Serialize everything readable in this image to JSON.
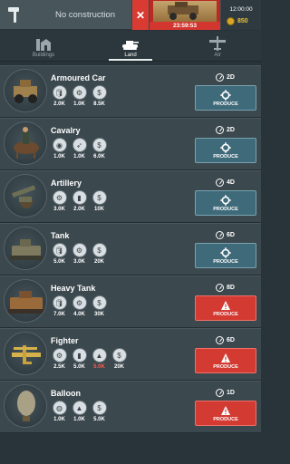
{
  "topbar": {
    "construction_text": "No construction",
    "cancel_symbol": "✕",
    "current_timer": "23:59:53",
    "clock_time": "12:00:00",
    "coins": "850"
  },
  "tabs": [
    {
      "label": "Buildings",
      "icon": "buildings-icon",
      "active": false
    },
    {
      "label": "Land",
      "icon": "tank-icon",
      "active": true
    },
    {
      "label": "Air",
      "icon": "plane-icon",
      "active": false
    }
  ],
  "units": [
    {
      "name": "Armoured Car",
      "duration": "2D",
      "status": "ready",
      "produce_label": "PRODUCE",
      "costs": [
        {
          "icon": "oil-icon",
          "value": "2.0K"
        },
        {
          "icon": "steel-icon",
          "value": "1.0K"
        },
        {
          "icon": "cash-icon",
          "value": "8.5K"
        }
      ]
    },
    {
      "name": "Cavalry",
      "duration": "2D",
      "status": "ready",
      "produce_label": "PRODUCE",
      "costs": [
        {
          "icon": "food-icon",
          "value": "1.0K"
        },
        {
          "icon": "rifle-icon",
          "value": "1.0K"
        },
        {
          "icon": "cash-icon",
          "value": "6.0K"
        }
      ]
    },
    {
      "name": "Artillery",
      "duration": "4D",
      "status": "ready",
      "produce_label": "PRODUCE",
      "costs": [
        {
          "icon": "steel-icon",
          "value": "3.0K"
        },
        {
          "icon": "ammo-icon",
          "value": "2.0K"
        },
        {
          "icon": "cash-icon",
          "value": "10K"
        }
      ]
    },
    {
      "name": "Tank",
      "duration": "6D",
      "status": "ready",
      "produce_label": "PRODUCE",
      "costs": [
        {
          "icon": "oil-icon",
          "value": "5.0K"
        },
        {
          "icon": "steel-icon",
          "value": "3.0K"
        },
        {
          "icon": "cash-icon",
          "value": "20K"
        }
      ]
    },
    {
      "name": "Heavy Tank",
      "duration": "8D",
      "status": "warning",
      "produce_label": "PRODUCE",
      "costs": [
        {
          "icon": "oil-icon",
          "value": "7.0K"
        },
        {
          "icon": "steel-icon",
          "value": "4.0K"
        },
        {
          "icon": "cash-icon",
          "value": "30K"
        }
      ]
    },
    {
      "name": "Fighter",
      "duration": "6D",
      "status": "warning",
      "produce_label": "PRODUCE",
      "costs": [
        {
          "icon": "steel-icon",
          "value": "2.5K",
          "short": false
        },
        {
          "icon": "ammo-icon",
          "value": "5.0K",
          "short": false
        },
        {
          "icon": "fuel-icon",
          "value": "5.0K",
          "short": true
        },
        {
          "icon": "cash-icon",
          "value": "20K",
          "short": false
        }
      ]
    },
    {
      "name": "Balloon",
      "duration": "1D",
      "status": "warning",
      "produce_label": "PRODUCE",
      "costs": [
        {
          "icon": "cloth-icon",
          "value": "1.0K"
        },
        {
          "icon": "fuel-icon",
          "value": "1.0K"
        },
        {
          "icon": "cash-icon",
          "value": "5.0K"
        }
      ]
    }
  ]
}
